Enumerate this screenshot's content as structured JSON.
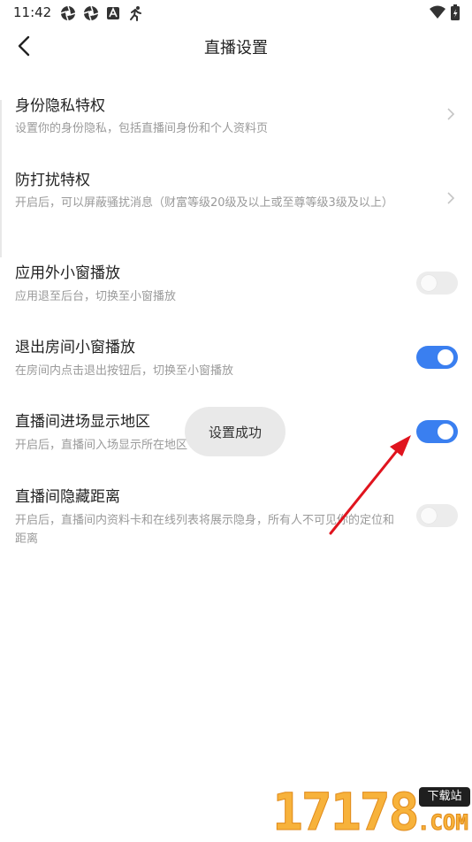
{
  "status_bar": {
    "time": "11:42",
    "left_icons": [
      "aperture-icon",
      "aperture-icon",
      "a-badge-icon",
      "runner-icon"
    ],
    "right_icons": [
      "wifi-icon",
      "battery-charging-icon"
    ]
  },
  "header": {
    "title": "直播设置",
    "back_icon": "back-arrow-icon"
  },
  "settings": [
    {
      "title": "身份隐私特权",
      "desc": "设置你的身份隐私，包括直播间身份和个人资料页",
      "control": "chevron"
    },
    {
      "title": "防打扰特权",
      "desc": "开启后，可以屏蔽骚扰消息（财富等级20级及以上或至尊等级3级及以上）",
      "control": "chevron"
    },
    {
      "title": "应用外小窗播放",
      "desc": "应用退至后台，切换至小窗播放",
      "control": "toggle",
      "on": false
    },
    {
      "title": "退出房间小窗播放",
      "desc": "在房间内点击退出按钮后，切换至小窗播放",
      "control": "toggle",
      "on": true
    },
    {
      "title": "直播间进场显示地区",
      "desc": "开启后，直播间入场显示所在地区",
      "control": "toggle",
      "on": true
    },
    {
      "title": "直播间隐藏距离",
      "desc": "开启后，直播间内资料卡和在线列表将展示隐身，所有人不可见你的定位和距离",
      "control": "toggle",
      "on": false
    }
  ],
  "toast": {
    "text": "设置成功"
  },
  "annotation": {
    "color": "#e0141e",
    "icon": "red-arrow-pointer"
  },
  "watermark": {
    "digits": "17178",
    "badge": "下载站",
    "suffix": ".COM"
  },
  "colors": {
    "accent": "#3a7ff0",
    "toggle_off": "#ececec",
    "desc_text": "#9a9a9a"
  }
}
